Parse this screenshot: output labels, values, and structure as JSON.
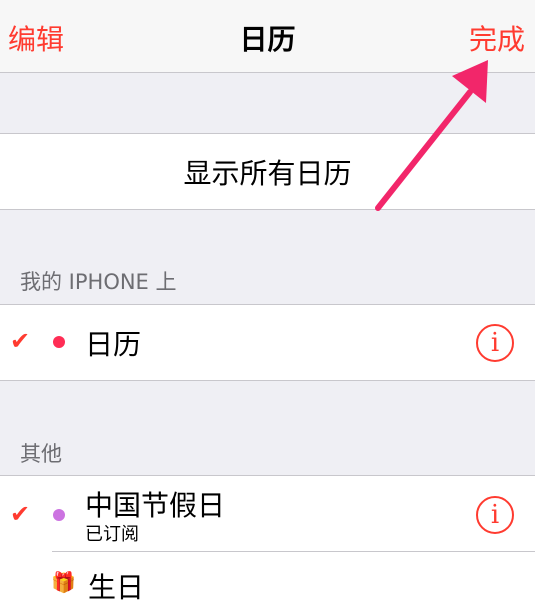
{
  "navbar": {
    "left_label": "编辑",
    "title": "日历",
    "right_label": "完成"
  },
  "show_all": {
    "label": "显示所有日历"
  },
  "sections": [
    {
      "header": "我的 IPHONE 上",
      "items": [
        {
          "title": "日历",
          "checked": true,
          "dot_color": "#ff2d55",
          "has_info": true
        }
      ]
    },
    {
      "header": "其他",
      "items": [
        {
          "title": "中国节假日",
          "subtitle": "已订阅",
          "checked": true,
          "dot_color": "#cc73e1",
          "has_info": true
        },
        {
          "title": "生日",
          "icon": "gift-icon"
        }
      ]
    }
  ],
  "colors": {
    "accent": "#ff3b30",
    "annotation_arrow": "#f2266a"
  }
}
